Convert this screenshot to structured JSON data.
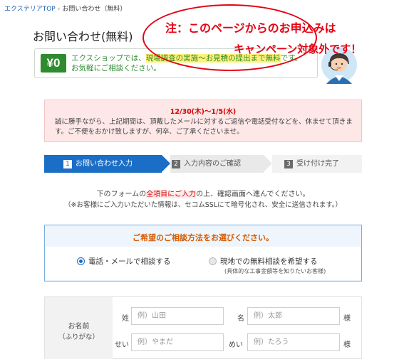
{
  "breadcrumb": {
    "home": "エクステリアTOP",
    "separator": "›",
    "current": "お問い合わせ（無料）"
  },
  "page_title": "お問い合わせ(無料)",
  "free_banner": {
    "badge": "¥0",
    "line1_before": "エクスショップでは、",
    "line1_highlight": "現場調査の実施〜お見積の提出まで無料",
    "line1_after": "です。",
    "line2": "お気軽にご相談ください。"
  },
  "notice_overlay": {
    "line1": "注：このページからのお申込みは",
    "line2": "キャンペーン対象外です！",
    "color": "#e60012"
  },
  "holiday_notice": {
    "date": "12/30(木)〜1/5(水)",
    "text": "誠に勝手ながら、上記期間は、頂戴したメールに対するご返信や電話受付などを、休ませて頂きます。ご不便をおかけ致しますが、何卒、ご了承くださいませ。"
  },
  "steps": [
    {
      "num": "1",
      "label": "お問い合わせ入力",
      "active": true
    },
    {
      "num": "2",
      "label": "入力内容のご確認",
      "active": false
    },
    {
      "num": "3",
      "label": "受け付け完了",
      "active": false
    }
  ],
  "intro": {
    "line1_before": "下のフォームの",
    "line1_highlight": "全項目にご入力",
    "line1_after": "の上、確認画面へ進んでください。",
    "line2": "（※お客様にご入力いただいた情報は、セコムSSLにて暗号化され、安全に送信されます。）"
  },
  "consult_method": {
    "title": "ご希望のご相談方法をお選びください。",
    "options": [
      {
        "label": "電話・メールで相談する",
        "selected": true,
        "note": ""
      },
      {
        "label": "現地での無料相談を希望する",
        "selected": false,
        "note": "(具体的な工事金額等を知りたいお客様)"
      }
    ]
  },
  "name_form": {
    "label_line1": "お名前",
    "label_line2": "（ふりがな）",
    "last_name_label": "姓",
    "last_name_placeholder": "例）山田",
    "first_name_label": "名",
    "first_name_placeholder": "例）太郎",
    "last_kana_label": "せい",
    "last_kana_placeholder": "例）やまだ",
    "first_kana_label": "めい",
    "first_kana_placeholder": "例）たろう",
    "honorific": "様"
  },
  "colors": {
    "accent_blue": "#1b6ec6",
    "free_green": "#2e8b2e",
    "warning_red": "#d60000",
    "orange_title": "#d65b00"
  }
}
